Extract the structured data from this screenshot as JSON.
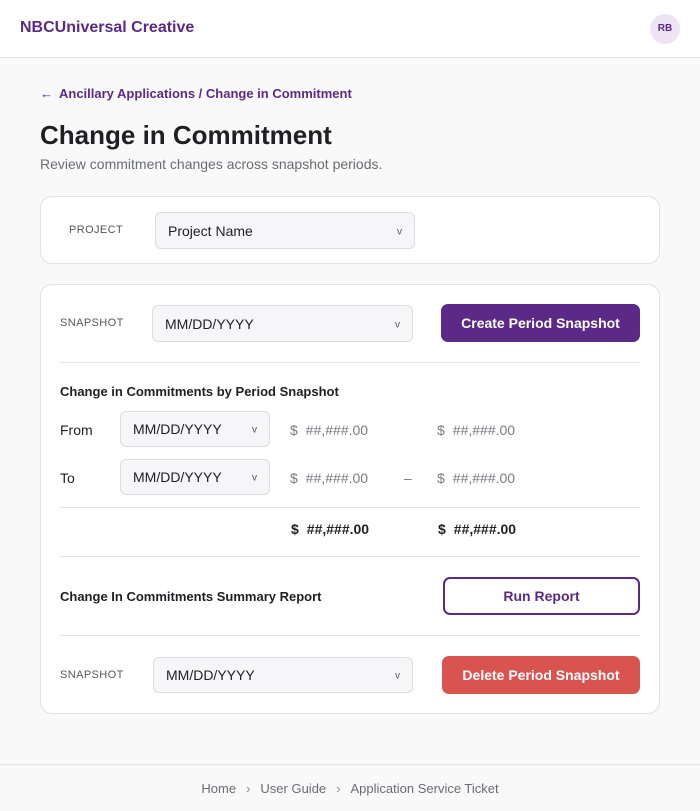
{
  "header": {
    "brand": "NBCUniversal Creative",
    "avatar_initials": "RB"
  },
  "breadcrumb": {
    "icon": "arrow-left-icon",
    "arrow": "←",
    "text": "Ancillary Applications / Change in Commitment"
  },
  "page": {
    "title": "Change in Commitment",
    "subtitle": "Review commitment changes across snapshot periods."
  },
  "project_card": {
    "label": "PROJECT",
    "select_value": "Project Name"
  },
  "snapshot_create": {
    "label": "SNAPSHOT",
    "select_value": "MM/DD/YYYY",
    "button_label": "Create Period Snapshot"
  },
  "changes": {
    "title": "Change in Commitments by Period Snapshot",
    "rows": [
      {
        "label": "From",
        "date": "MM/DD/YYYY",
        "currency_a": "$",
        "amount_a": "##,###.00",
        "currency_b": "$",
        "amount_b": "##,###.00",
        "operator": ""
      },
      {
        "label": "To",
        "date": "MM/DD/YYYY",
        "currency_a": "$",
        "amount_a": "##,###.00",
        "currency_b": "$",
        "amount_b": "##,###.00",
        "operator": "–"
      }
    ],
    "totals": {
      "currency_a": "$",
      "amount_a": "##,###.00",
      "currency_b": "$",
      "amount_b": "##,###.00"
    }
  },
  "summary_report": {
    "title": "Change In Commitments Summary Report",
    "button_label": "Run Report"
  },
  "snapshot_delete": {
    "label": "SNAPSHOT",
    "select_value": "MM/DD/YYYY",
    "button_label": "Delete Period Snapshot"
  },
  "footer": {
    "links": [
      "Home",
      "User Guide",
      "Application Service Ticket"
    ],
    "separator": "›"
  },
  "colors": {
    "brand_purple": "#5b2a86",
    "danger_red": "#d9534f",
    "background": "#f9f9fa"
  }
}
